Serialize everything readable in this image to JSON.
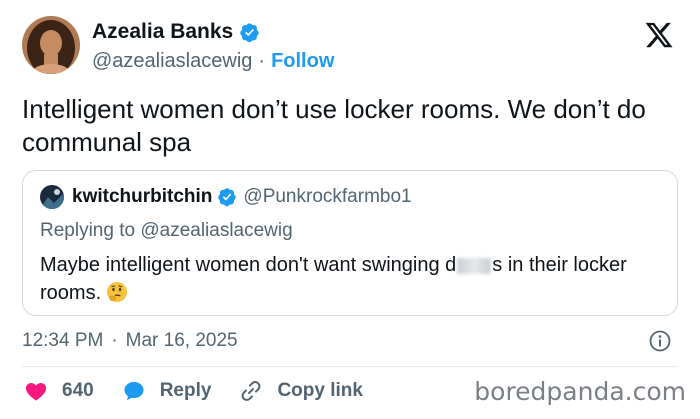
{
  "tweet": {
    "author": {
      "display_name": "Azealia Banks",
      "handle": "@azealiaslacewig",
      "verified": true,
      "follow_label": "Follow",
      "separator": "·"
    },
    "text": "Intelligent women don’t use locker rooms. We don’t do communal spa",
    "quoted": {
      "display_name": "kwitchurbitchin",
      "handle": "@Punkrockfarmbo1",
      "verified": true,
      "replying_to": "Replying to @azealiaslacewig",
      "text_before": "Maybe intelligent women don't want swinging d",
      "text_after": "s in their locker rooms.",
      "emoji": "thinking-face"
    },
    "time": "12:34 PM",
    "meta_separator": "·",
    "date": "Mar 16, 2025",
    "actions": {
      "likes": "640",
      "reply_label": "Reply",
      "copy_label": "Copy link"
    }
  },
  "watermark": "boredpanda.com",
  "colors": {
    "accent": "#1d9bf0",
    "like": "#f91880",
    "muted": "#536471",
    "border": "#cfd9de"
  },
  "icons": [
    "x-logo-icon",
    "verified-badge-icon",
    "heart-icon",
    "reply-bubble-icon",
    "link-icon",
    "info-icon",
    "thinking-emoji-icon"
  ]
}
